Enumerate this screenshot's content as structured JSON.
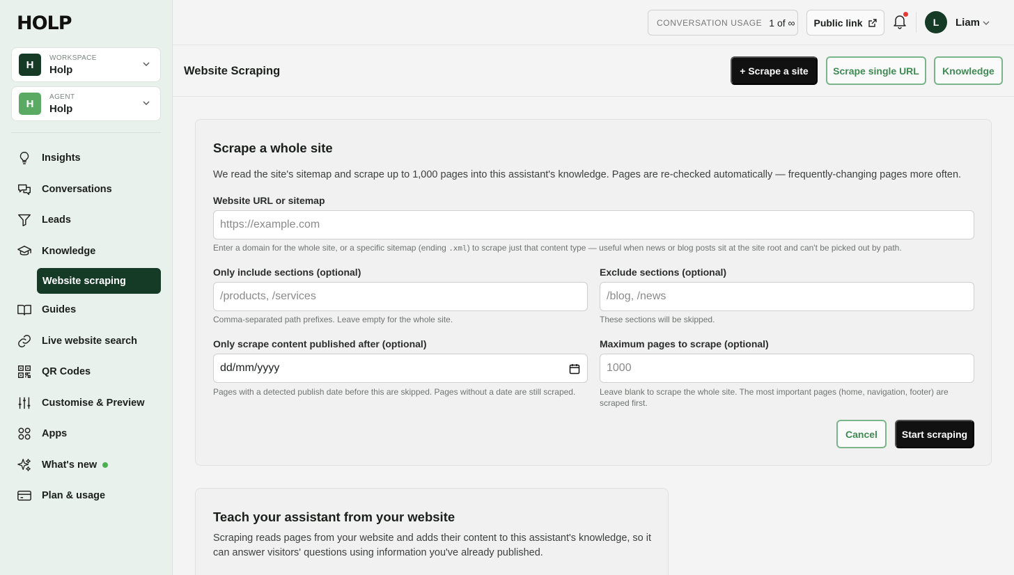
{
  "brand": {
    "logo": "HOLP"
  },
  "workspace": {
    "caption": "WORKSPACE",
    "value": "Holp",
    "initial": "H"
  },
  "agent": {
    "caption": "AGENT",
    "value": "Holp",
    "initial": "H"
  },
  "nav": {
    "insights": "Insights",
    "conversations": "Conversations",
    "leads": "Leads",
    "knowledge": "Knowledge",
    "website_scraping": "Website scraping",
    "guides": "Guides",
    "live_search": "Live website search",
    "qr_codes": "QR Codes",
    "customise": "Customise & Preview",
    "apps": "Apps",
    "whats_new": "What's new",
    "plan": "Plan & usage"
  },
  "topbar": {
    "usage_label": "CONVERSATION USAGE",
    "usage_value": "1 of ∞",
    "public_link": "Public link",
    "user_initial": "L",
    "user_name": "Liam"
  },
  "header": {
    "title": "Website Scraping",
    "scrape_site": "+  Scrape a site",
    "scrape_single": "Scrape single URL",
    "knowledge": "Knowledge"
  },
  "form": {
    "title": "Scrape a whole site",
    "description": "We read the site's sitemap and scrape up to 1,000 pages into this assistant's knowledge. Pages are re-checked automatically — frequently-changing pages more often.",
    "url_label": "Website URL or sitemap",
    "url_placeholder": "https://example.com",
    "url_hint_1": "Enter a domain for the whole site, or a specific sitemap (ending ",
    "url_hint_code": ".xml",
    "url_hint_2": ") to scrape just that content type — useful when news or blog posts sit at the site root and can't be picked out by path.",
    "include_label": "Only include sections (optional)",
    "include_placeholder": "/products, /services",
    "include_hint": "Comma-separated path prefixes. Leave empty for the whole site.",
    "exclude_label": "Exclude sections (optional)",
    "exclude_placeholder": "/blog, /news",
    "exclude_hint": "These sections will be skipped.",
    "date_label": "Only scrape content published after (optional)",
    "date_placeholder": "dd/mm/yyyy",
    "date_hint": "Pages with a detected publish date before this are skipped. Pages without a date are still scraped.",
    "max_label": "Maximum pages to scrape (optional)",
    "max_placeholder": "1000",
    "max_hint": "Leave blank to scrape the whole site. The most important pages (home, navigation, footer) are scraped first.",
    "cancel": "Cancel",
    "start": "Start scraping"
  },
  "teach": {
    "title": "Teach your assistant from your website",
    "description": "Scraping reads pages from your website and adds their content to this assistant's knowledge, so it can answer visitors' questions using information you've already published."
  },
  "colors": {
    "brand_dark": "#153a26",
    "accent_green": "#3e8a52",
    "agent_badge": "#5aaa64",
    "notification": "#e53935"
  }
}
